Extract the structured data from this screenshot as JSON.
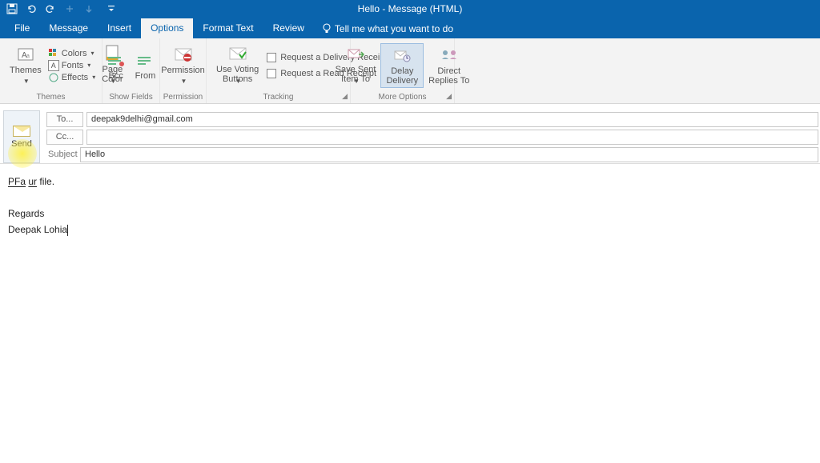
{
  "title": "Hello  -  Message (HTML)",
  "tabs": {
    "file": "File",
    "message": "Message",
    "insert": "Insert",
    "options": "Options",
    "format_text": "Format Text",
    "review": "Review",
    "tell_me": "Tell me what you want to do"
  },
  "ribbon": {
    "themes": {
      "label": "Themes",
      "themes_btn": "Themes",
      "colors": "Colors",
      "fonts": "Fonts",
      "effects": "Effects",
      "page_color": "Page\nColor"
    },
    "show_fields": {
      "label": "Show Fields",
      "bcc": "Bcc",
      "from": "From"
    },
    "permission": {
      "label": "Permission",
      "btn": "Permission"
    },
    "tracking": {
      "label": "Tracking",
      "voting": "Use Voting\nButtons",
      "delivery": "Request a Delivery Receipt",
      "read": "Request a Read Receipt"
    },
    "more_options": {
      "label": "More Options",
      "save_sent": "Save Sent\nItem To",
      "delay": "Delay\nDelivery",
      "direct": "Direct\nReplies To"
    }
  },
  "compose": {
    "send": "Send",
    "to_label": "To...",
    "cc_label": "Cc...",
    "subject_label": "Subject",
    "to_value": "deepak9delhi@gmail.com",
    "cc_value": "",
    "subject_value": "Hello"
  },
  "body": {
    "line1a": "PFa",
    "line1b": "ur",
    "line1c": " file.",
    "regards": "Regards",
    "signature": "Deepak Lohia"
  }
}
